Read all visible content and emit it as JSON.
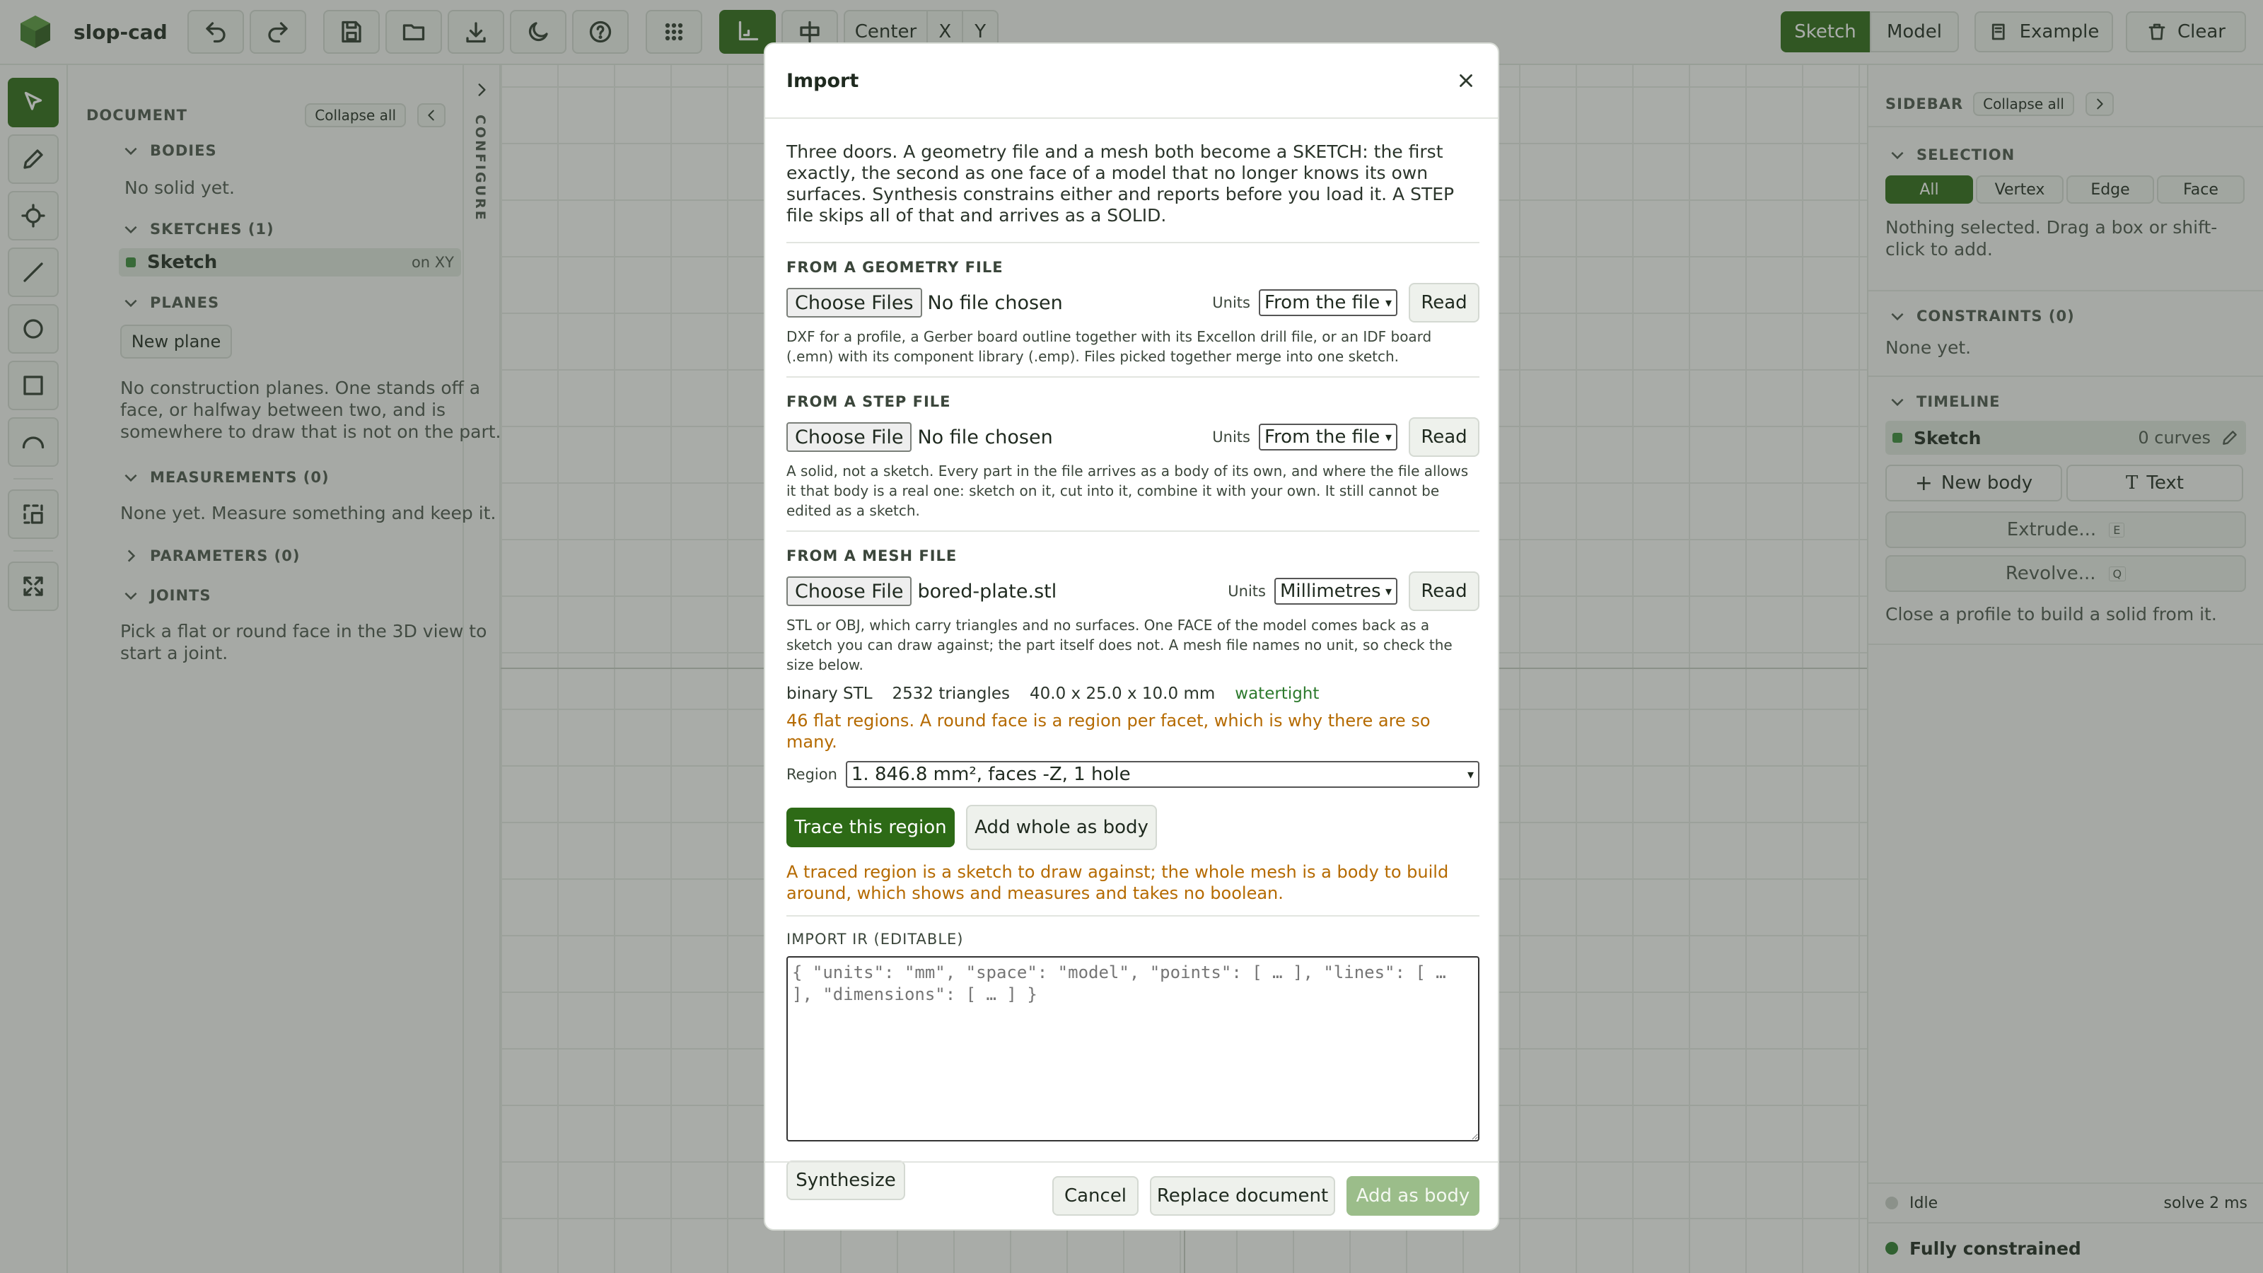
{
  "app": {
    "title": "slop-cad"
  },
  "toolbar": {
    "center_label": "Center",
    "x_label": "X",
    "y_label": "Y",
    "sketch_label": "Sketch",
    "model_label": "Model",
    "example_label": "Example",
    "clear_label": "Clear"
  },
  "document": {
    "title": "DOCUMENT",
    "collapse_all": "Collapse all",
    "bodies_title": "BODIES",
    "bodies_empty": "No solid yet.",
    "sketches_title": "SKETCHES (1)",
    "sketch_item_label": "Sketch",
    "sketch_item_plane": "on XY",
    "planes_title": "PLANES",
    "new_plane": "New plane",
    "planes_empty": "No construction planes. One stands off a face, or halfway between two, and is somewhere to draw that is not on the part.",
    "measurements_title": "MEASUREMENTS (0)",
    "measurements_empty": "None yet. Measure something and keep it.",
    "parameters_title": "PARAMETERS (0)",
    "joints_title": "JOINTS",
    "joints_empty": "Pick a flat or round face in the 3D view to start a joint."
  },
  "configure_label": "CONFIGURE",
  "sidebar": {
    "title": "SIDEBAR",
    "collapse_all": "Collapse all",
    "selection_title": "SELECTION",
    "selection_tabs": [
      "All",
      "Vertex",
      "Edge",
      "Face"
    ],
    "selection_empty": "Nothing selected. Drag a box or shift-click to add.",
    "constraints_title": "CONSTRAINTS (0)",
    "constraints_empty": "None yet.",
    "timeline_title": "TIMELINE",
    "timeline_item_label": "Sketch",
    "timeline_item_count": "0 curves",
    "new_body": "New body",
    "text_btn": "Text",
    "extrude": "Extrude...",
    "extrude_key": "E",
    "revolve": "Revolve...",
    "revolve_key": "Q",
    "hint": "Close a profile to build a solid from it."
  },
  "status": {
    "idle": "Idle",
    "solve": "solve 2 ms",
    "constrained": "Fully constrained"
  },
  "dialog": {
    "title": "Import",
    "intro": "Three doors. A geometry file and a mesh both become a SKETCH: the first exactly, the second as one face of a model that no longer knows its own surfaces. Synthesis constrains either and reports before you load it. A STEP file skips all of that and arrives as a SOLID.",
    "geometry": {
      "title": "FROM A GEOMETRY FILE",
      "choose": "Choose Files",
      "chosen": "No file chosen",
      "units_label": "Units",
      "units_value": "From the file",
      "read": "Read",
      "help": "DXF for a profile, a Gerber board outline together with its Excellon drill file, or an IDF board (.emn) with its component library (.emp). Files picked together merge into one sketch."
    },
    "step": {
      "title": "FROM A STEP FILE",
      "choose": "Choose File",
      "chosen": "No file chosen",
      "units_label": "Units",
      "units_value": "From the file",
      "read": "Read",
      "help": "A solid, not a sketch. Every part in the file arrives as a body of its own, and where the file allows it that body is a real one: sketch on it, cut into it, combine it with your own. It still cannot be edited as a sketch."
    },
    "mesh": {
      "title": "FROM A MESH FILE",
      "choose": "Choose File",
      "chosen": "bored-plate.stl",
      "units_label": "Units",
      "units_value": "Millimetres",
      "read": "Read",
      "help": "STL or OBJ, which carry triangles and no surfaces. One FACE of the model comes back as a sketch you can draw against; the part itself does not. A mesh file names no unit, so check the size below.",
      "format": "binary STL",
      "triangles": "2532 triangles",
      "size": "40.0 x 25.0 x 10.0 mm",
      "watertight": "watertight",
      "regions_note": "46 flat regions. A round face is a region per facet, which is why there are so many.",
      "region_label": "Region",
      "region_value": "1. 846.8 mm², faces -Z, 1 hole",
      "trace": "Trace this region",
      "add_whole": "Add whole as body",
      "trace_note": "A traced region is a sketch to draw against; the whole mesh is a body to build around, which shows and measures and takes no boolean."
    },
    "ir": {
      "title": "IMPORT IR (EDITABLE)",
      "placeholder": "{ \"units\": \"mm\", \"space\": \"model\", \"points\": [ … ], \"lines\": [ … ], \"dimensions\": [ … ] }",
      "synthesize": "Synthesize"
    },
    "footer": {
      "cancel": "Cancel",
      "replace": "Replace document",
      "add": "Add as body"
    }
  },
  "colors": {
    "accent": "#2d6a16",
    "warning": "#b56a00",
    "status_ok": "#2d7a2d"
  }
}
